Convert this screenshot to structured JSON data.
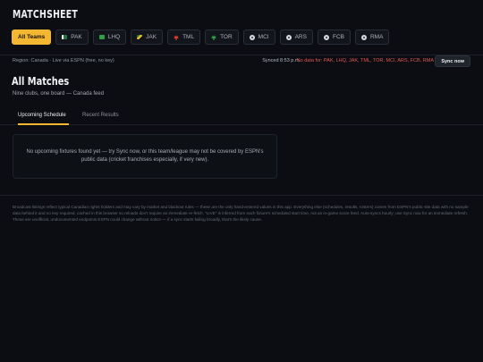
{
  "app": {
    "brand": "MATCHSHEET"
  },
  "team_bar": [
    {
      "label": "All Teams",
      "active": true
    },
    {
      "label": "PAK",
      "icon": "pakistan-flag-icon",
      "color": "#1f7a3a"
    },
    {
      "label": "LHQ",
      "icon": "lahore-qalandars-icon",
      "color": "#2f9e44"
    },
    {
      "label": "JAK",
      "icon": "jamaica-flag-icon",
      "color": "#e4c21b"
    },
    {
      "label": "TML",
      "icon": "maple-leaf-icon",
      "color": "#d93b2f"
    },
    {
      "label": "TOR",
      "icon": "toronto-fc-icon",
      "color": "#2f9e44"
    },
    {
      "label": "MCI",
      "icon": "soccer-ball-icon"
    },
    {
      "label": "ARS",
      "icon": "soccer-ball-icon"
    },
    {
      "label": "FCB",
      "icon": "soccer-ball-icon"
    },
    {
      "label": "RMA",
      "icon": "soccer-ball-icon"
    }
  ],
  "status": {
    "region": "Region: Canada · Live via ESPN (free, no key)",
    "synced": "Synced 8:53 p.m.",
    "no_data": "No data for: PAK, LHQ, JAK, TML, TOR, MCI, ARS, FCB, RMA",
    "sync_button": "Sync now"
  },
  "page": {
    "title": "All Matches",
    "subtitle": "Nine clubs, one board — Canada feed"
  },
  "tabs": [
    {
      "label": "Upcoming Schedule",
      "active": true
    },
    {
      "label": "Recent Results",
      "active": false
    }
  ],
  "empty_state": {
    "message": "No upcoming fixtures found yet — try Sync now, or this team/league may not be covered by ESPN's public data (cricket franchises especially, if very new)."
  },
  "footer": {
    "note": "Broadcast listings reflect typical Canadian rights holders and may vary by market and blackout rules — these are the only hand-entered values in this app. Everything else (schedules, results, rosters) comes from ESPN's public site data with no sample data behind it and no key required, cached in this browser so reloads don't require an immediate re-fetch. \"LIVE\" is inferred from each fixture's scheduled start time, not an in-game score feed. Auto-syncs hourly; use Sync now for an immediate refresh. These are unofficial, undocumented endpoints ESPN could change without notice — if a sync starts failing broadly, that's the likely cause."
  },
  "colors": {
    "accent": "#f3b731",
    "error": "#e0584e",
    "background": "#0b0d12"
  }
}
